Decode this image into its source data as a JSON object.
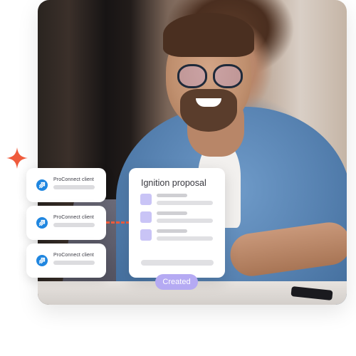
{
  "hero": {
    "photo_alt": "Smiling man with glasses in denim shirt at desk with laptop"
  },
  "client_cards": [
    {
      "label": "ProConnect client",
      "icon": "proconnect-arrow-icon"
    },
    {
      "label": "ProConnect client",
      "icon": "proconnect-arrow-icon"
    },
    {
      "label": "ProConnect client",
      "icon": "proconnect-arrow-icon"
    }
  ],
  "proposal": {
    "title": "Ignition proposal",
    "rows": 3,
    "status_label": "Created"
  },
  "colors": {
    "accent_orange": "#ef5b3c",
    "proconnect_blue": "#1f86e0",
    "lavender": "#b5aaf3",
    "lavender_light": "#c9c4f6"
  }
}
